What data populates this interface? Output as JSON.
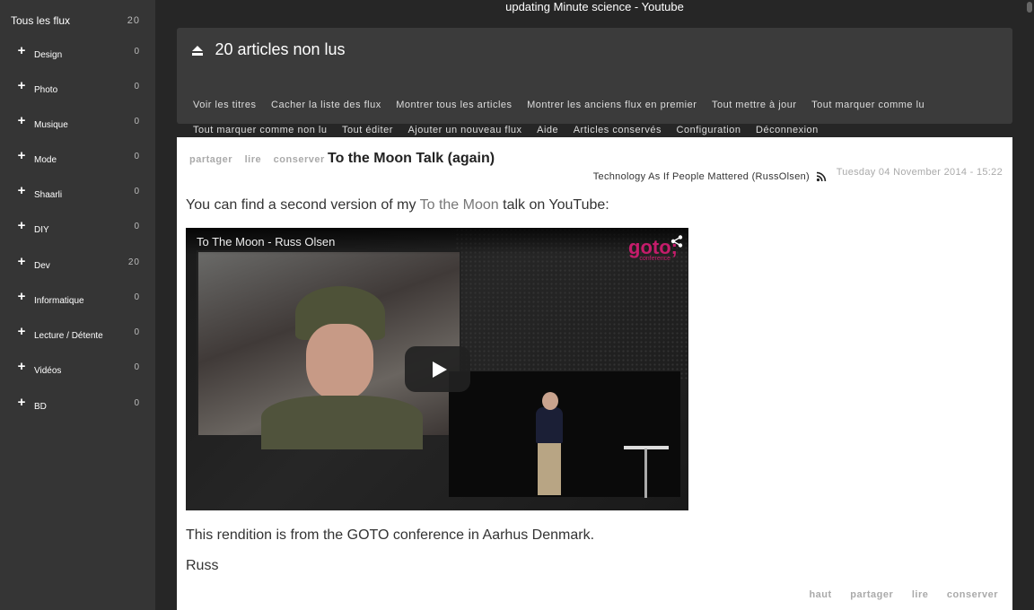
{
  "status": "updating Minute science - Youtube",
  "sidebar": {
    "all_feeds": {
      "label": "Tous les flux",
      "count": "20"
    },
    "categories": [
      {
        "label": "Design",
        "count": "0"
      },
      {
        "label": "Photo",
        "count": "0"
      },
      {
        "label": "Musique",
        "count": "0"
      },
      {
        "label": "Mode",
        "count": "0"
      },
      {
        "label": "Shaarli",
        "count": "0"
      },
      {
        "label": "DIY",
        "count": "0"
      },
      {
        "label": "Dev",
        "count": "20"
      },
      {
        "label": "Informatique",
        "count": "0"
      },
      {
        "label": "Lecture / Détente",
        "count": "0"
      },
      {
        "label": "Vidéos",
        "count": "0"
      },
      {
        "label": "BD",
        "count": "0"
      }
    ]
  },
  "topbar": {
    "unread_title": "20 articles non lus",
    "menu_row1": [
      "Voir les titres",
      "Cacher la liste des flux",
      "Montrer tous les articles",
      "Montrer les anciens flux en premier",
      "Tout mettre à jour",
      "Tout marquer comme lu"
    ],
    "menu_row2": [
      "Tout marquer comme non lu",
      "Tout éditer",
      "Ajouter un nouveau flux",
      "Aide",
      "Articles conservés",
      "Configuration",
      "Déconnexion"
    ]
  },
  "article": {
    "actions": {
      "share": "partager",
      "read": "lire",
      "keep": "conserver"
    },
    "title": "To the Moon Talk (again)",
    "source": "Technology As If People Mattered (RussOlsen)",
    "date": "Tuesday 04 November 2014 - 15:22",
    "p1_before": "You can find a second version of my ",
    "p1_link": "To the Moon",
    "p1_after": " talk on YouTube:",
    "video": {
      "title": "To The Moon - Russ Olsen",
      "logo": "goto;",
      "logo_sub": "conference"
    },
    "p2": "This rendition is from the GOTO conference in Aarhus Denmark.",
    "p3": "Russ",
    "footer": {
      "top": "haut",
      "share": "partager",
      "read": "lire",
      "keep": "conserver"
    }
  }
}
